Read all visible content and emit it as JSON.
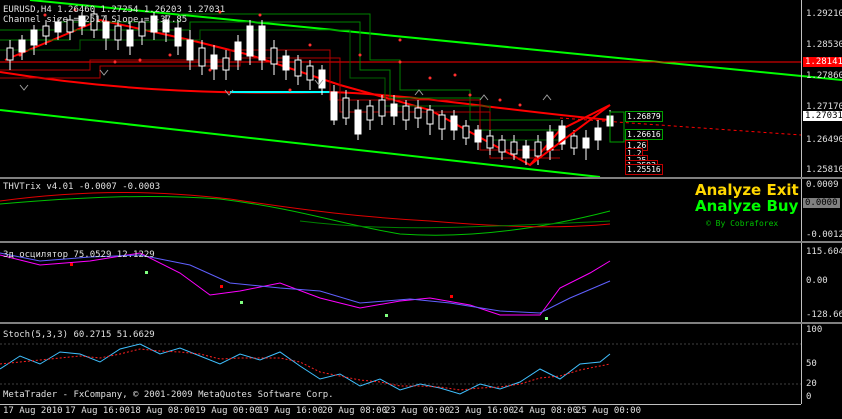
{
  "main_chart": {
    "header": "EURUSD,H4  1.26460 1.27254 1.26203 1.27031",
    "sub_header": "Channel size = 2517 Slope = -37.85",
    "price_labels": [
      "1.29210",
      "1.28530",
      "1.27860",
      "1.27170",
      "1.26490",
      "1.25810"
    ],
    "red_tag": "1.28141",
    "current_tag": "1.27031",
    "level_labels": [
      "1.26879",
      "1.26616",
      "1.26",
      "1.2",
      "1.25",
      "1.2593",
      "1.25516"
    ],
    "colors": {
      "channel": "#00ff00",
      "trend": "#ff0000",
      "bull": "#ffffff",
      "bear": "#000000"
    }
  },
  "indicator1": {
    "header": "THVTrix v4.01 -0.0007 -0.0003",
    "labels": [
      "0.0009",
      "0.0000",
      "-0.0012"
    ],
    "value_tag": "0.0000",
    "analyze_exit": "Analyze Exit",
    "analyze_buy": "Analyze Buy",
    "credit": "© By Cobraforex",
    "colors": {
      "exit": "#ffd700",
      "buy": "#00ff00"
    }
  },
  "indicator2": {
    "header": "Зд осцилятор 75.0529 12.1229",
    "labels": [
      "115.604",
      "0.00",
      "-128.664"
    ]
  },
  "indicator3": {
    "header": "Stoch(5,3,3) 60.2715 51.6629",
    "labels": [
      "100",
      "50",
      "20",
      "0"
    ]
  },
  "footer": {
    "copyright": "MetaTrader - FxCompany, © 2001-2009 MetaQuotes Software Corp."
  },
  "time_axis": [
    "17 Aug 2010",
    "17 Aug 16:00",
    "18 Aug 08:00",
    "19 Aug 00:00",
    "19 Aug 16:00",
    "20 Aug 08:00",
    "23 Aug 00:00",
    "23 Aug 16:00",
    "24 Aug 08:00",
    "25 Aug 00:00"
  ]
}
